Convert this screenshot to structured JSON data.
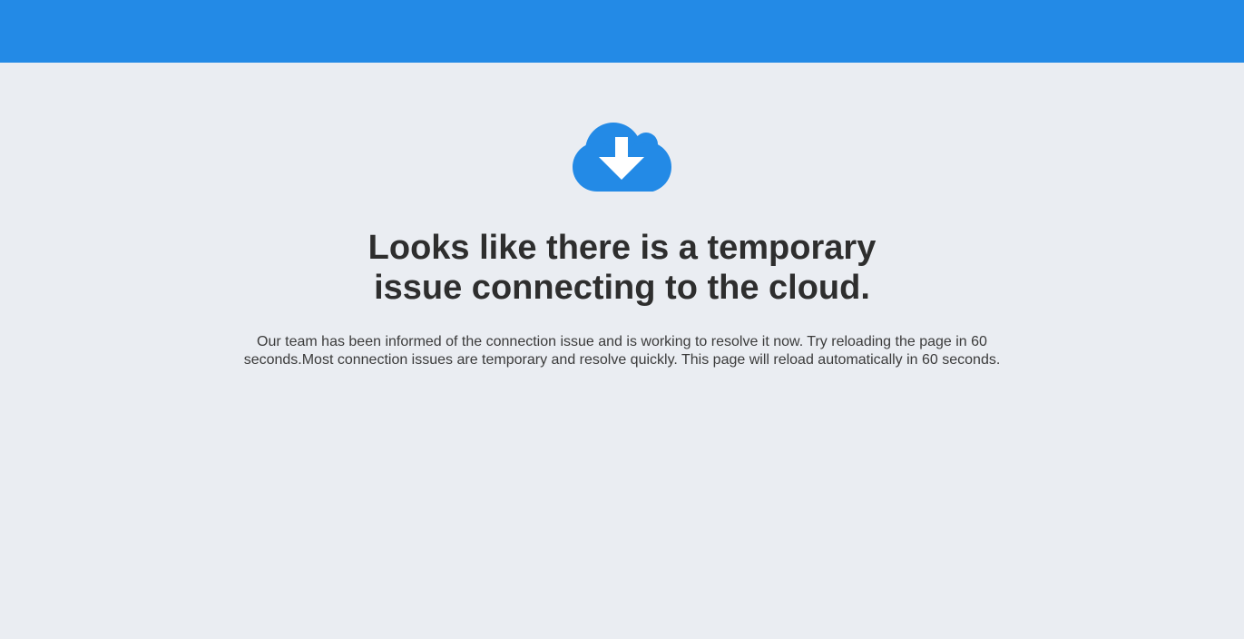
{
  "header": {
    "color": "#238ae6"
  },
  "main": {
    "icon": "cloud-download-icon",
    "icon_color": "#238ae6",
    "title": "Looks like there is a temporary issue connecting to the cloud.",
    "message": "Our team has been informed of the connection issue and is working to resolve it now. Try reloading the page in 60 seconds.Most connection issues are temporary and resolve quickly. This page will reload automatically in 60 seconds."
  }
}
